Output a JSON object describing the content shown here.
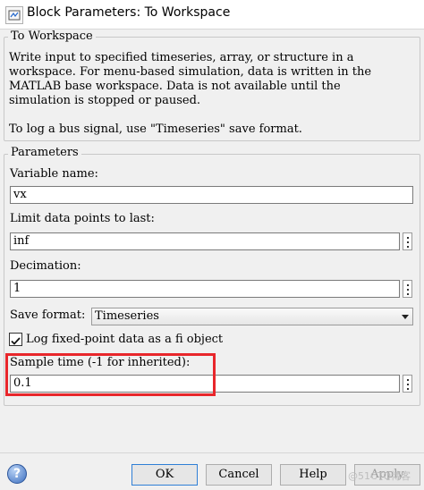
{
  "window": {
    "title": "Block Parameters: To Workspace"
  },
  "block": {
    "name": "To Workspace",
    "description": "Write input to specified timeseries, array, or structure in a\nworkspace. For menu-based simulation, data is written in the\nMATLAB base workspace. Data is not available until the\nsimulation is stopped or paused.\n\nTo log a bus signal, use \"Timeseries\" save format."
  },
  "parameters": {
    "group_label": "Parameters",
    "variable_name_label": "Variable name:",
    "variable_name_value": "vx",
    "limit_label": "Limit data points to last:",
    "limit_value": "inf",
    "decimation_label": "Decimation:",
    "decimation_value": "1",
    "save_format_label": "Save format:",
    "save_format_value": "Timeseries",
    "log_fixed_point_label": "Log fixed-point data as a fi object",
    "log_fixed_point_checked": true,
    "sample_time_label": "Sample time (-1 for inherited):",
    "sample_time_value": "0.1"
  },
  "buttons": {
    "ok": "OK",
    "cancel": "Cancel",
    "help": "Help",
    "apply": "Apply"
  },
  "watermark": "@51CTO博客",
  "colors": {
    "highlight": "#e8262b",
    "focus_border": "#2f7fd6"
  }
}
